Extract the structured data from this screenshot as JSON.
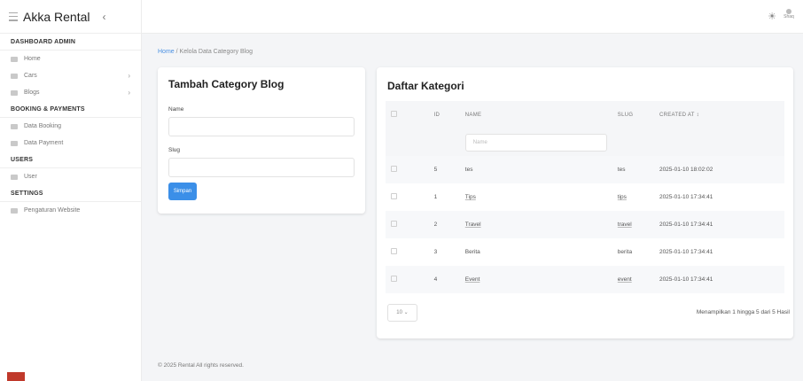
{
  "sidebar": {
    "brand": "Akka Rental",
    "collapse_icon": "‹",
    "sections": [
      {
        "label": "DASHBOARD ADMIN",
        "items": [
          {
            "label": "Home",
            "chevron": false
          },
          {
            "label": "Cars",
            "chevron": true
          },
          {
            "label": "Blogs",
            "chevron": true
          }
        ]
      },
      {
        "label": "BOOKING & PAYMENTS",
        "items": [
          {
            "label": "Data Booking",
            "chevron": false
          },
          {
            "label": "Data Payment",
            "chevron": false
          }
        ]
      },
      {
        "label": "USERS",
        "items": [
          {
            "label": "User",
            "chevron": false
          }
        ]
      },
      {
        "label": "SETTINGS",
        "items": [
          {
            "label": "Pengaturan Website",
            "chevron": false
          }
        ]
      }
    ]
  },
  "topbar": {
    "theme_icon": "sun-icon",
    "avatar_label": "Shaq"
  },
  "breadcrumb": {
    "home": "Home",
    "separator": " / ",
    "current": "Kelola Data Category Blog"
  },
  "form": {
    "title": "Tambah Category Blog",
    "name_label": "Name",
    "slug_label": "Slug",
    "save_label": "Simpan"
  },
  "table": {
    "title": "Daftar Kategori",
    "columns": [
      "ID",
      "NAME",
      "SLUG",
      "CREATED AT"
    ],
    "sort_indicator": "↕",
    "filter_placeholder": "Name",
    "rows": [
      {
        "id": "5",
        "name": "tes",
        "slug": "tes",
        "created_at": "2025-01-10 18:02:02"
      },
      {
        "id": "1",
        "name": "Tips",
        "slug": "tips",
        "created_at": "2025-01-10 17:34:41"
      },
      {
        "id": "2",
        "name": "Travel",
        "slug": "travel",
        "created_at": "2025-01-10 17:34:41"
      },
      {
        "id": "3",
        "name": "Berita",
        "slug": "berita",
        "created_at": "2025-01-10 17:34:41"
      },
      {
        "id": "4",
        "name": "Event",
        "slug": "event",
        "created_at": "2025-01-10 17:34:41"
      }
    ],
    "page_size": "10",
    "pager_info": "Menampilkan 1 hingga 5 dari 5 Hasil"
  },
  "footer": "© 2025 Rental All rights reserved.",
  "colors": {
    "accent": "#3b8fe8",
    "badge": "#c0392b"
  }
}
